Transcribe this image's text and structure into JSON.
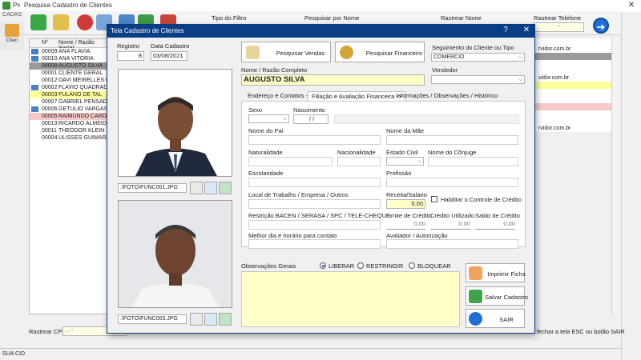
{
  "outer": {
    "title": "Proj",
    "subtitle": "CADAS",
    "left_strip_label": "Clien",
    "filters": {
      "tipo_label": "Tipo do Filtro",
      "pesquisar_label": "Pesquisar por Nome",
      "rastrear_nome_label": "Rastrear Nome",
      "rastrear_tel_label": "Rastrear Telefone",
      "tel_value": "-"
    },
    "grid_headers": {
      "num": "Nº",
      "nome": "Nome / Razão Social"
    },
    "rows": [
      {
        "code": "00009",
        "name": "ANA FLAVIA",
        "color": "#ffffff"
      },
      {
        "code": "00010",
        "name": "ANA VITORIA",
        "color": "#ffffff"
      },
      {
        "code": "00008",
        "name": "AUGUSTO SILVA",
        "color": "#9a9a9a"
      },
      {
        "code": "00001",
        "name": "CLIENTE GERAL",
        "color": "#ffffff"
      },
      {
        "code": "00012",
        "name": "DAVI MEIRELLES QU",
        "color": "#ffffff"
      },
      {
        "code": "00002",
        "name": "FLAVIO QUADRADO",
        "color": "#ffffff"
      },
      {
        "code": "00003",
        "name": "FULANO DE TAL",
        "color": "#ffff9a"
      },
      {
        "code": "00007",
        "name": "GABRIEL PENSADO",
        "color": "#ffffff"
      },
      {
        "code": "00006",
        "name": "GETULIO VARGAS",
        "color": "#ffffff"
      },
      {
        "code": "00005",
        "name": "RAIMUNDO CARDOS",
        "color": "#f7c9c9"
      },
      {
        "code": "00013",
        "name": "RICARDO ALMEIDA",
        "color": "#ffffff"
      },
      {
        "code": "00011",
        "name": "THEODOR KLEIN",
        "color": "#ffffff"
      },
      {
        "code": "00004",
        "name": "ULISSES GUIMARAE",
        "color": "#ffffff"
      }
    ],
    "right_values": [
      "",
      "rvidor.com.br",
      "",
      "",
      "",
      "vidor.com.br",
      "",
      "",
      "",
      "",
      "",
      "",
      "rvidor.com.br"
    ],
    "rastrear_cpf_label": "Rastrear CPF",
    "rastrear_cpf_value": ". . -",
    "hint": "fechar a tela ESC ou botão SAIR",
    "status": "SUA CID"
  },
  "dialog": {
    "title": "Tela Cadastro de Clientes",
    "registro_label": "Registro",
    "registro_value": "8",
    "data_label": "Data Cadastro",
    "data_value": "03/08/2021",
    "btn_vendas": "Pesquisar Vendas",
    "btn_financeiro": "Pesquisar  Financeiro",
    "seguimento_label": "Seguimento do Cliente ou Tipo",
    "seguimento_value": "COMERCIO",
    "nome_label": "Nome / Razão Completo",
    "nome_value": "AUGUSTO SILVA",
    "vendedor_label": "Vendedor",
    "vendedor_value": "",
    "tabs": [
      "Endereço e Contatos ->",
      "Filiação e Avaliação Financeira ->",
      "Informações / Observações / Histórico"
    ],
    "sexo_label": "Sexo",
    "nascimento_label": "Nascimento",
    "nascimento_value": "/ /",
    "pai_label": "Nome do Pai",
    "mae_label": "Nome da Mãe",
    "naturalidade_label": "Naturalidade",
    "nacionalidade_label": "Nacionalidade",
    "estado_civil_label": "Estado Civil",
    "conjuge_label": "Nome do Cônjuge",
    "escolaridade_label": "Escolaridade",
    "profissao_label": "Profissão",
    "trabalho_label": "Local de Trabalho / Empresa / Outros",
    "receita_label": "Receita/Salario",
    "receita_value": "0.00",
    "habilitar_label": "Habilitar o Controle de Crédito",
    "restricao_label": "Restrição BACEN / SERASA / SPC / TELE-CHEQUE",
    "limite_label": "Limite de Crédito",
    "limite_value": "0.00",
    "utilizado_label": "Crédito Utilizado",
    "utilizado_value": "0.00",
    "saldo_label": "Saldo de Crédito",
    "saldo_value": "0.00",
    "melhor_dia_label": "Melhor dia e horário para contato",
    "avaliador_label": "Avaliador / Autorização",
    "obs_label": "Observações Gerais",
    "radio_liberar": "LIBERAR",
    "radio_restringir": "RESTRINGIR",
    "radio_bloquear": "BLOQUEAR",
    "btn_imprimir": "Imprimir Ficha",
    "btn_salvar": "Salvar Cadastro",
    "btn_sair": "SAIR",
    "foto1_path": ".\\FOTO\\FUNC001.JPG",
    "foto2_path": ".\\FOTO\\FUNC003.JPG"
  },
  "colors": {
    "title_bar": "#0a3f88",
    "selected_row": "#9a9a9a",
    "highlight_yellow": "#ffff9a",
    "highlight_red": "#f7c9c9",
    "input_yellow": "#ffffc8"
  }
}
